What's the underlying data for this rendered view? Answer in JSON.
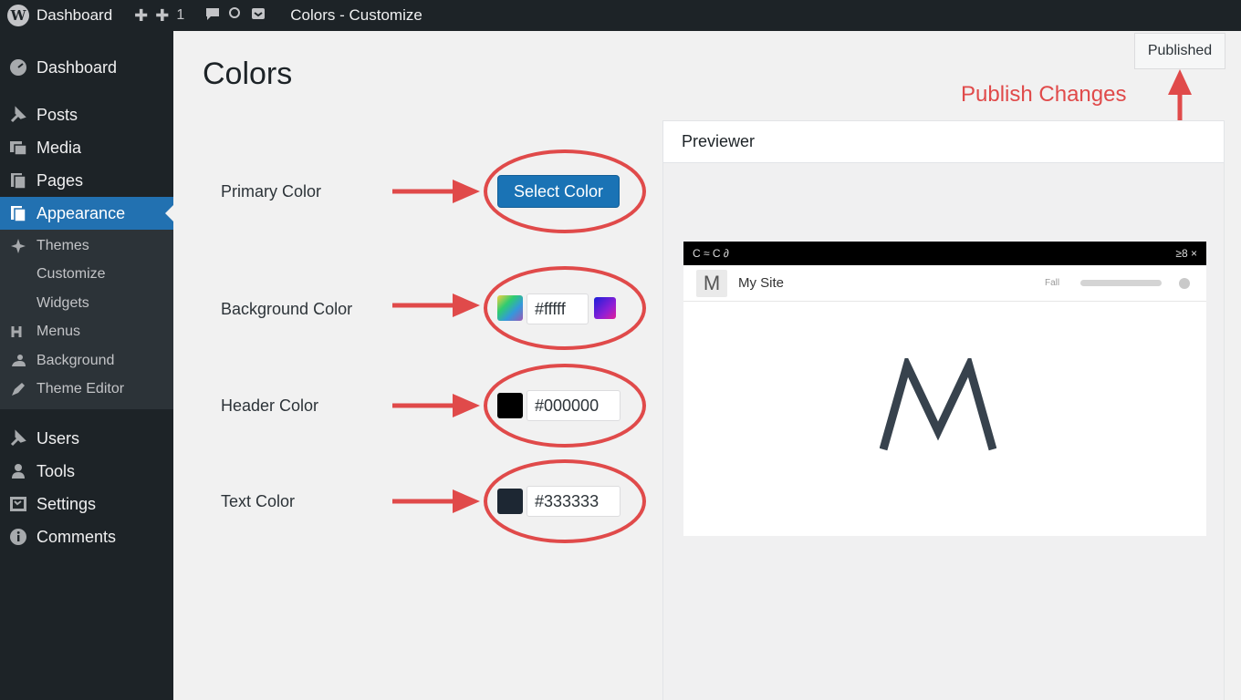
{
  "adminbar": {
    "dashboard_label": "Dashboard",
    "count": "1",
    "page_title": "Colors - Customize"
  },
  "sidebar": {
    "items": [
      {
        "label": "Dashboard",
        "icon": "dashboard-icon"
      },
      {
        "label": "Posts",
        "icon": "pin-icon"
      },
      {
        "label": "Media",
        "icon": "media-icon"
      },
      {
        "label": "Pages",
        "icon": "pages-icon"
      },
      {
        "label": "Appearance",
        "icon": "appearance-icon",
        "active": true
      },
      {
        "label": "Themes",
        "icon": "themes-icon"
      },
      {
        "label": "Customize"
      },
      {
        "label": "Widgets"
      },
      {
        "label": "Menus",
        "icon": "menus-icon"
      },
      {
        "label": "Background",
        "icon": "background-icon"
      },
      {
        "label": "Theme Editor",
        "icon": "theme-editor-icon"
      },
      {
        "label": "Users",
        "icon": "users-icon"
      },
      {
        "label": "Tools",
        "icon": "tools-icon"
      },
      {
        "label": "Settings",
        "icon": "settings-icon"
      },
      {
        "label": "Comments",
        "icon": "comments-icon"
      }
    ]
  },
  "main": {
    "title": "Colors",
    "primary_color": {
      "label": "Primary Color",
      "button": "Select Color"
    },
    "background_color": {
      "label": "Background Color",
      "value": "#fffff"
    },
    "header_color": {
      "label": "Header Color",
      "value": "#000000",
      "swatch": "#000000"
    },
    "text_color": {
      "label": "Text Color",
      "value": "#333333",
      "swatch": "#1d2733"
    }
  },
  "publish": {
    "button": "Published",
    "annotation": "Publish Changes"
  },
  "previewer": {
    "title": "Previewer",
    "site_name": "My Site",
    "nav_text": "Fall",
    "logo_letter": "M",
    "bar_text_left": "C  ≈ C ∂",
    "bar_text_right": "≥8 ×"
  },
  "colors": {
    "accent": "#2271b1",
    "annotation_red": "#e04a4a",
    "sidebar_bg": "#1d2327"
  }
}
